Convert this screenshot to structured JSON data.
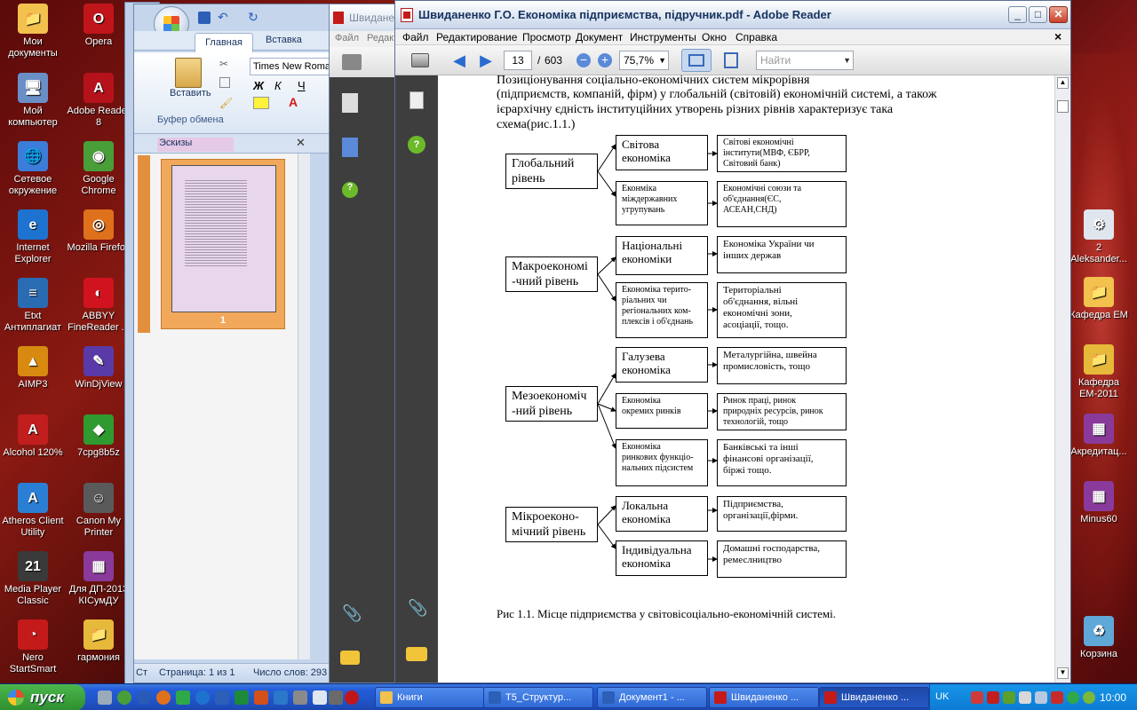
{
  "desktop": {
    "left_icons": [
      {
        "label": "Мои\nдокументы",
        "color": "#f2c14e",
        "glyph": "📁"
      },
      {
        "label": "Opera",
        "color": "#c0161b",
        "glyph": "O"
      },
      {
        "label": "Мой\nкомпьютер",
        "color": "#6a8fc7",
        "glyph": "🖥"
      },
      {
        "label": "Adobe Reader\n8",
        "color": "#b5121b",
        "glyph": "A"
      },
      {
        "label": "Сетевое\nокружение",
        "color": "#3b7dd8",
        "glyph": "🌐"
      },
      {
        "label": "Google\nChrome",
        "color": "#4a9e3a",
        "glyph": "◉"
      },
      {
        "label": "Internet\nExplorer",
        "color": "#1e73d0",
        "glyph": "e"
      },
      {
        "label": "Mozilla Firefox",
        "color": "#e0711c",
        "glyph": "◎"
      },
      {
        "label": "Etxt\nАнтиплагиат",
        "color": "#2a6cb3",
        "glyph": "≡"
      },
      {
        "label": "ABBYY\nFineReader ...",
        "color": "#d1121f",
        "glyph": "◐"
      },
      {
        "label": "AIMP3",
        "color": "#d88a10",
        "glyph": "▲"
      },
      {
        "label": "WinDjView",
        "color": "#5a3aa8",
        "glyph": "✎"
      },
      {
        "label": "Alcohol 120%",
        "color": "#c21e1e",
        "glyph": "A"
      },
      {
        "label": "7cpg8b5z",
        "color": "#2f9a2f",
        "glyph": "◆"
      },
      {
        "label": "Atheros Client\nUtility",
        "color": "#2a7fd4",
        "glyph": "A"
      },
      {
        "label": "Canon My\nPrinter",
        "color": "#5a5a5a",
        "glyph": "☺"
      },
      {
        "label": "Media Player\nClassic",
        "color": "#3a3a3a",
        "glyph": "21"
      },
      {
        "label": "Для ДП-2013\nКІСумДУ",
        "color": "#8a3a9a",
        "glyph": "▦"
      },
      {
        "label": "Nero\nStartSmart",
        "color": "#c41a1a",
        "glyph": "◔"
      },
      {
        "label": "гармония",
        "color": "#e6b93a",
        "glyph": "📁"
      }
    ],
    "right_icons": [
      {
        "label": "2\nAleksander...",
        "color": "#dfe6ee",
        "glyph": "⚙"
      },
      {
        "label": "Кафедра ЕМ",
        "color": "#f2c14e",
        "glyph": "📁"
      },
      {
        "label": "Кафедра\nЕМ-2011",
        "color": "#e6b93a",
        "glyph": "📁"
      },
      {
        "label": "Акредитац...",
        "color": "#8a3a9a",
        "glyph": "▦"
      },
      {
        "label": "Minus60",
        "color": "#8a3a9a",
        "glyph": "▦"
      },
      {
        "label": "Корзина",
        "color": "#5fa8d8",
        "glyph": "♻"
      }
    ]
  },
  "word": {
    "tabs": [
      "Главная",
      "Вставка"
    ],
    "font_name": "Times New Roman",
    "paste_label": "Вставить",
    "clipboard_group": "Буфер обмена",
    "thumbs_pane_title": "Эскизы",
    "thumb_page_number": "1",
    "status_page": "Страница: 1 из 1",
    "status_words": "Число слов: 293",
    "status_left": "Ст"
  },
  "reader_back": {
    "title": "Швиданенко Г.О. Економіка підприємства, підручник.pdf",
    "menu": [
      "Файл",
      "Редактирование"
    ]
  },
  "reader": {
    "title": "Швиданенко Г.О. Економіка підприємства, підручник.pdf - Adobe Reader",
    "menu": [
      "Файл",
      "Редактирование",
      "Просмотр",
      "Документ",
      "Инструменты",
      "Окно",
      "Справка"
    ],
    "page_current": "13",
    "page_total": "603",
    "zoom": "75,7%",
    "search_placeholder": "Найти",
    "close_doc_label": "×",
    "intro_lines": [
      "Позиціонування соціально-економічних систем мікрорівня",
      "(підприємств, компаній, фірм) у глобальній (світовій) економічній системі, а також",
      "ієрархічну єдність інституційних утворень різних рівнів характеризує така",
      "схема(рис.1.1.)"
    ],
    "diagram": {
      "levels": [
        {
          "label": "Глобальний\nрівень"
        },
        {
          "label": "Макроекономі\n-чний рівень"
        },
        {
          "label": "Мезоекономіч\n-ний рівень"
        },
        {
          "label": "Мікроеконо-\nмічний рівень"
        }
      ],
      "middle": [
        {
          "label": "Світова\nекономіка"
        },
        {
          "label": "Еконміка\nміждержавних\nугрупувань"
        },
        {
          "label": "Національні\nекономіки"
        },
        {
          "label": "Економіка терито-\nріальних чи\nрегіональних ком-\nплексів і об'єднань"
        },
        {
          "label": "Галузева\nекономіка"
        },
        {
          "label": "Економіка\nокремих ринків"
        },
        {
          "label": "Економіка\nринкових функціо-\nнальних підсистем"
        },
        {
          "label": "Локальна\nекономіка"
        },
        {
          "label": "Індивідуальна\nекономіка"
        }
      ],
      "right": [
        {
          "label": "Світові економічні\nінститути(МВФ, ЄБРР,\nСвітовий банк)"
        },
        {
          "label": "Економічні союзи та\nоб'єднання(ЄС,\nАСЕАН,СНД)"
        },
        {
          "label": "Економіка України чи\nінших держав"
        },
        {
          "label": "Територіальні\nоб'єднання, вільні\nекономічні зони,\nасоціації, тощо."
        },
        {
          "label": "Металургійна, швейна\nпромисловість, тощо"
        },
        {
          "label": "Ринок праці, ринок\nприродніх ресурсів, ринок\nтехнологій, тощо"
        },
        {
          "label": "Банківські та інші\nфінансові організації,\nбіржі тощо."
        },
        {
          "label": "Підприємства,\nорганізації,фірми."
        },
        {
          "label": "Домашні господарства,\nремеслництво"
        }
      ]
    },
    "caption": "Рис 1.1. Місце підприємства у світовісоціально-економічній системі."
  },
  "taskbar": {
    "start_label": "пуск",
    "tasks": [
      {
        "label": "Книги",
        "color": "#f2c14e"
      },
      {
        "label": "T5_Структур...",
        "color": "#2b5fb8"
      },
      {
        "label": "Документ1 - ...",
        "color": "#2b5fb8"
      },
      {
        "label": "Швиданенко ...",
        "color": "#c41a1a"
      },
      {
        "label": "Швиданенко ...",
        "color": "#c41a1a"
      }
    ],
    "language": "UK",
    "clock": "10:00"
  }
}
